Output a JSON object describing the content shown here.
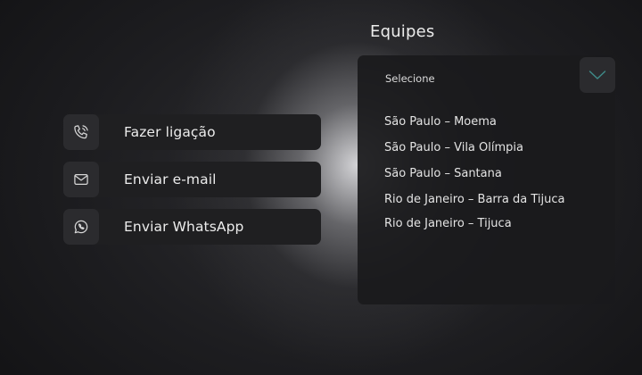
{
  "contact_actions": [
    {
      "label": "Fazer ligação",
      "icon": "phone-icon"
    },
    {
      "label": "Enviar e-mail",
      "icon": "mail-icon"
    },
    {
      "label": "Enviar WhatsApp",
      "icon": "whatsapp-icon"
    }
  ],
  "teams": {
    "title": "Equipes",
    "dropdown": {
      "placeholder": "Selecione",
      "toggle_icon": "chevron-down-icon",
      "options": [
        "São Paulo – Moema",
        "São Paulo – Vila Olímpia",
        "São Paulo – Santana",
        "Rio de Janeiro – Barra da Tijuca",
        "Rio de Janeiro – Tijuca"
      ]
    }
  },
  "colors": {
    "surface": "#1f1f21",
    "icon_tile": "#2b2b2e",
    "chevron": "#3f8c8a",
    "text": "#ececec"
  }
}
